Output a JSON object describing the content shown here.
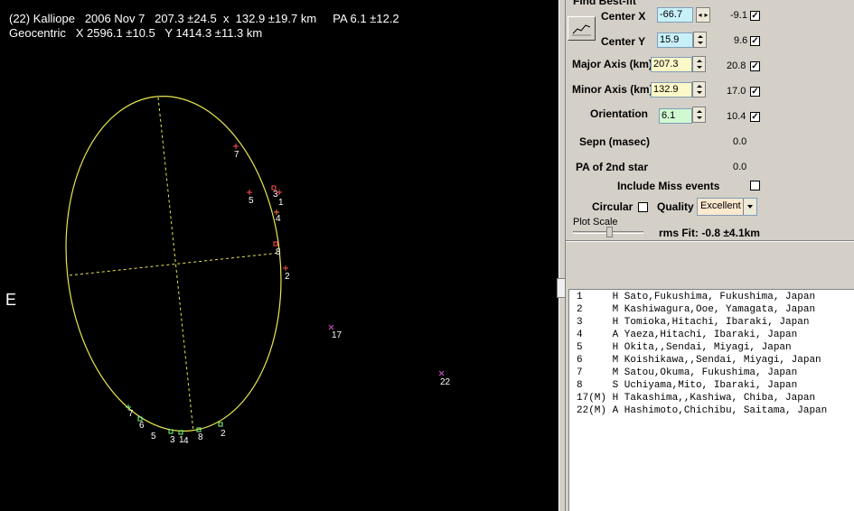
{
  "header": {
    "line1": "(22) Kalliope   2006 Nov 7   207.3 ±24.5  x  132.9 ±19.7 km     PA 6.1 ±12.2",
    "line2": "Geocentric   X 2596.1 ±10.5   Y 1414.3 ±11.3 km"
  },
  "plot": {
    "east_label": "E",
    "ellipse_color": "#e8e850",
    "axis_color": "#e8e850",
    "chords": [
      {
        "id": "7",
        "color": "#ff5050"
      },
      {
        "id": "5",
        "color": "#ff5050"
      },
      {
        "id": "3",
        "color": "#ff5050"
      },
      {
        "id": "1",
        "color": "#ff5050"
      },
      {
        "id": "4",
        "color": "#ff8030"
      },
      {
        "id": "8",
        "color": "#ff5050"
      },
      {
        "id": "2",
        "color": "#ff5050"
      }
    ],
    "bottom_labels": [
      "7",
      "6",
      "5",
      "3",
      "1",
      "4",
      "8",
      "2"
    ],
    "miss_events": [
      "17",
      "22"
    ],
    "miss_color": "#d050d0"
  },
  "panel": {
    "group_title": "Find Best-fit",
    "center_x": {
      "label": "Center X",
      "value": "-66.7",
      "uncert": "-9.1",
      "checked": true,
      "bg": "#c8f0f8"
    },
    "center_y": {
      "label": "Center Y",
      "value": "15.9",
      "uncert": "9.6",
      "checked": true,
      "bg": "#c8f0f8"
    },
    "major": {
      "label": "Major Axis (km)",
      "value": "207.3",
      "uncert": "20.8",
      "checked": true,
      "bg": "#fdf8c8"
    },
    "minor": {
      "label": "Minor Axis (km)",
      "value": "132.9",
      "uncert": "17.0",
      "checked": true,
      "bg": "#fdf8c8"
    },
    "orient": {
      "label": "Orientation",
      "value": "6.1",
      "uncert": "10.4",
      "checked": true,
      "bg": "#d0f8d0"
    },
    "sepn": {
      "label": "Sepn (masec)",
      "value": "0.0"
    },
    "pa2": {
      "label": "PA of 2nd star",
      "value": "0.0"
    },
    "include_miss": "Include Miss events",
    "circular": "Circular",
    "quality_label": "Quality",
    "quality_value": "Excellent",
    "plot_scale": "Plot Scale",
    "rms_fit": "rms Fit: -0.8 ±4.1km"
  },
  "observers": [
    "1     H Sato,Fukushima, Fukushima, Japan",
    "2     M Kashiwagura,Ooe, Yamagata, Japan",
    "3     H Tomioka,Hitachi, Ibaraki, Japan",
    "4     A Yaeza,Hitachi, Ibaraki, Japan",
    "5     H Okita,,Sendai, Miyagi, Japan",
    "6     M Koishikawa,,Sendai, Miyagi, Japan",
    "7     M Satou,Okuma, Fukushima, Japan",
    "8     S Uchiyama,Mito, Ibaraki, Japan",
    "17(M) H Takashima,,Kashiwa, Chiba, Japan",
    "22(M) A Hashimoto,Chichibu, Saitama, Japan"
  ]
}
